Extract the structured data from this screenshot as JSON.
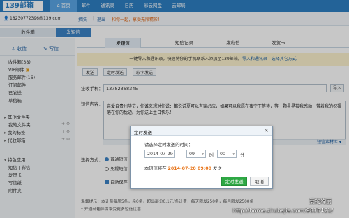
{
  "logo": "139邮箱",
  "nav": {
    "home": "首页",
    "items": [
      "邮件",
      "通讯录",
      "日历",
      "彩云网盘",
      "云邮局"
    ]
  },
  "userbar": {
    "account": "18230772396@139.com",
    "switch": "换肤",
    "logout": "退出",
    "promo": "和你一起，享受无限精彩！"
  },
  "left_tabs": {
    "inbox": "收件箱",
    "send_sms": "发短信"
  },
  "sidebar": {
    "receive": "收信",
    "compose": "写信",
    "items": [
      "收件箱(38)",
      "VIP邮件",
      "服务邮件(16)",
      "订阅邮件",
      "已发送",
      "草稿箱"
    ],
    "groups": [
      "其他文件夹",
      "我的文件夹",
      "我的标签",
      "代收邮箱"
    ],
    "apps_group": "特色应用",
    "apps": [
      "短信 | 彩信",
      "发贺卡",
      "写信纸",
      "附件夹"
    ]
  },
  "subtabs": [
    "发短信",
    "短信记录",
    "发彩信",
    "发贺卡"
  ],
  "notice": {
    "text": "一键导入和通讯录，快速将你的手机联系人添加至139邮箱。",
    "link": "导入和通讯录 | 选择其它方式"
  },
  "actions": [
    "发送",
    "定时发送",
    "彩字发送"
  ],
  "form": {
    "to_label": "接收手机：",
    "to_value": "13782368345",
    "import": "导入",
    "content_label": "短信内容：",
    "content": "亲爱自贵州毕节，你谁来想对你说：都说说夏可以有家必应，如果可以我愿在夜空下等待，等一颗星星被我感动，带着我的祝福落在你的枕边。为你送上生日快乐！",
    "library": "短信素材库",
    "options_label": "选择方式：",
    "option1": "普通短信",
    "option2": "免提短信",
    "autosave": "自动保存",
    "tip": "温馨提示：本计费每周5条，余0条，超出部分0.1元/条计费，每天限发250条，每月限发2500条",
    "tip2": "* 开通邮箱伴侣享受更多短信优惠"
  },
  "dialog": {
    "title": "定时发送",
    "prompt": "请选择定时发送的时间：",
    "date": "2014-07-20",
    "hour": "09",
    "hour_unit": "时",
    "minute": "00",
    "minute_unit": "分",
    "summary_prefix": "本短信将在",
    "summary_time": "2014-07-20 09:00",
    "summary_suffix": "发送",
    "ok": "定时发送",
    "cancel": "取消",
    "close": "×"
  },
  "watermark": {
    "line1": "爱的绚丽",
    "line2": "http://home.zhubajie.com/9835421/"
  }
}
